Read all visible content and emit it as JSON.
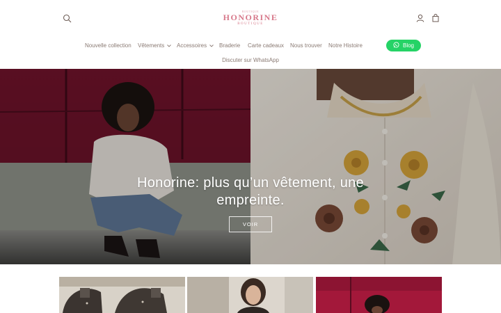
{
  "header": {
    "logo": {
      "top_text": "BOUTIQUE",
      "main": "HONORINE",
      "sub": "BOUTIQUE"
    },
    "search_icon": "search-icon",
    "account_icon": "account-icon",
    "cart_icon": "cart-icon"
  },
  "nav": {
    "items": [
      {
        "label": "Nouvelle collection",
        "dropdown": false
      },
      {
        "label": "Vêtements",
        "dropdown": true
      },
      {
        "label": "Accessoires",
        "dropdown": true
      },
      {
        "label": "Braderie",
        "dropdown": false
      },
      {
        "label": "Carte cadeaux",
        "dropdown": false
      },
      {
        "label": "Nous trouver",
        "dropdown": false
      },
      {
        "label": "Notre Histoire",
        "dropdown": false
      }
    ],
    "second_row": "Discuter sur WhatsApp"
  },
  "whatsapp_button": {
    "label": "Blog",
    "icon": "whatsapp-icon",
    "color": "#25d366"
  },
  "hero": {
    "title_line1": "Honorine: plus qu’un vêtement, une",
    "title_line2": "empreinte.",
    "cta": "VOIR"
  },
  "colors": {
    "accent": "#d7788a",
    "nav_text": "#8a7a73",
    "whatsapp": "#25d366"
  }
}
